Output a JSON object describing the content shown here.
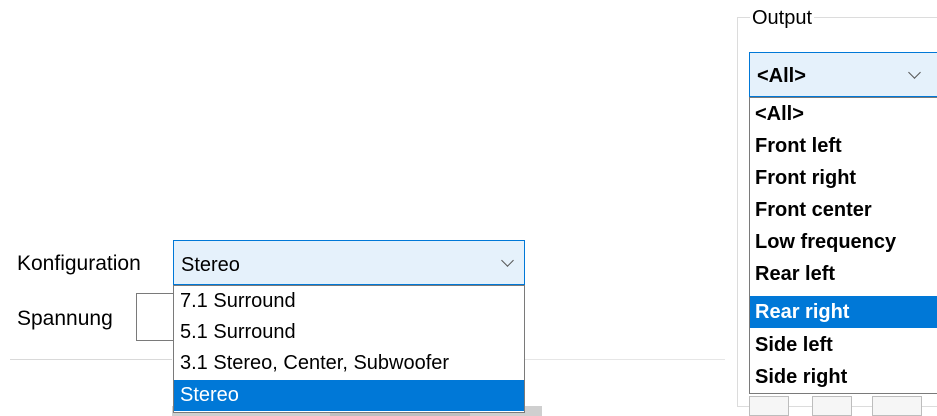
{
  "konfiguration": {
    "label": "Konfiguration",
    "selected": "Stereo",
    "options": [
      {
        "label": "7.1 Surround",
        "selected": false
      },
      {
        "label": "5.1 Surround",
        "selected": false
      },
      {
        "label": "3.1 Stereo, Center, Subwoofer",
        "selected": false
      },
      {
        "label": "Stereo",
        "selected": true
      }
    ]
  },
  "spannung": {
    "label": "Spannung",
    "value": ""
  },
  "output": {
    "legend": "Output",
    "selected": "<All>",
    "options": [
      {
        "label": "<All>",
        "selected": false
      },
      {
        "label": "Front left",
        "selected": false
      },
      {
        "label": "Front right",
        "selected": false
      },
      {
        "label": "Front center",
        "selected": false
      },
      {
        "label": "Low frequency",
        "selected": false
      },
      {
        "label": "Rear left",
        "selected": false
      },
      {
        "label": "Rear right",
        "selected": true
      },
      {
        "label": "Side left",
        "selected": false
      },
      {
        "label": "Side right",
        "selected": false
      }
    ]
  },
  "colors": {
    "accent": "#0078d7",
    "combo_background": "#e5f1fb",
    "dropdown_border": "#7a7a7a"
  },
  "icons": {
    "combo_arrow": "chevron-down-icon"
  }
}
